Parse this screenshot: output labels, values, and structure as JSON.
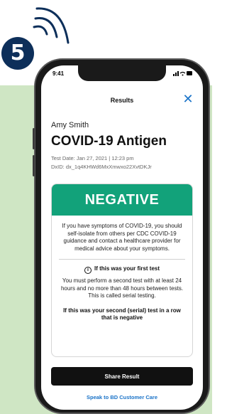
{
  "step": {
    "number": "5"
  },
  "status_bar": {
    "time": "9:41"
  },
  "nav": {
    "title": "Results",
    "close_glyph": "✕"
  },
  "patient": {
    "name": "Amy Smith"
  },
  "test": {
    "name": "COVID-19 Antigen",
    "date": "Test Date: Jan 27, 2021 | 12:23 pm",
    "dxid": "DxID: dx_1q4KHWd6MxXmwxo22XvtDKJr"
  },
  "result": {
    "status": "NEGATIVE",
    "status_color": "#12a27a",
    "advice": "If you have symptoms of COVID-19, you should self-isolate from others per CDC COVID-19 guidance and contact a healthcare provider for medical advice about your symptoms.",
    "info_icon": "ⓘ",
    "first_test_heading": "If this was your first test",
    "first_test_body": "You must perform a second test with at least 24 hours and no more than 48 hours between tests. This is called serial testing.",
    "second_test_heading": "If this was your second (serial) test in a row that is negative"
  },
  "actions": {
    "share_label": "Share Result",
    "care_link": "Speak to BD Customer Care"
  },
  "colors": {
    "badge": "#0d2f5a",
    "accent_link": "#1a73c8",
    "background_panel": "#cfe6c4"
  }
}
